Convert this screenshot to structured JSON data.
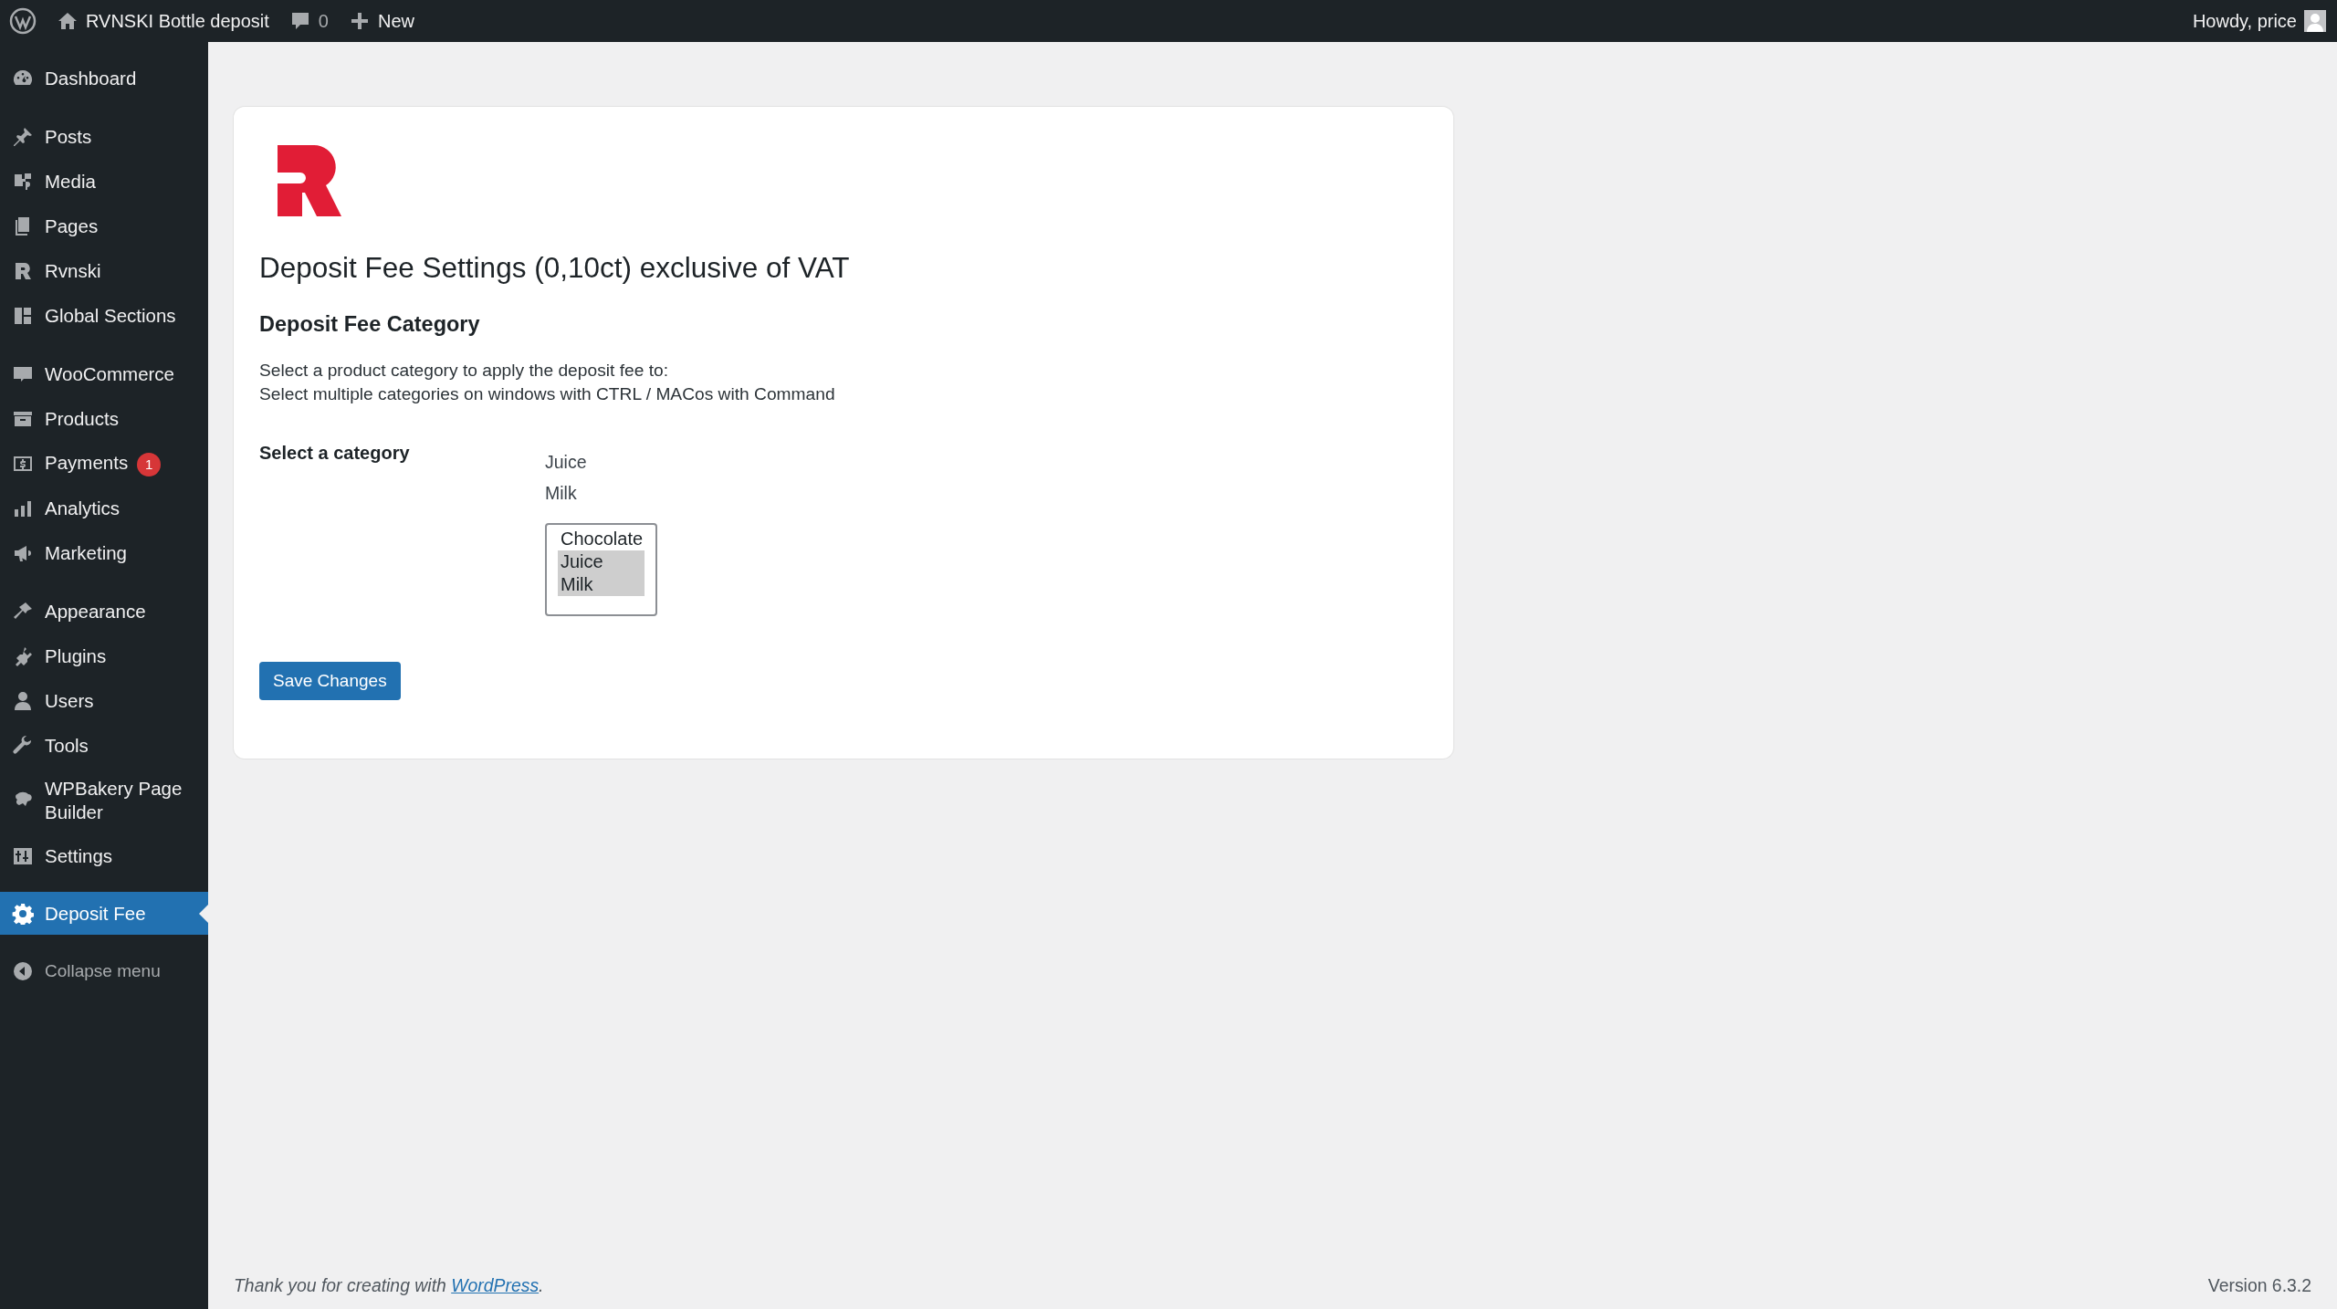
{
  "admin_bar": {
    "site_title": "RVNSKI Bottle deposit",
    "comments_count": "0",
    "new_label": "New",
    "greeting": "Howdy, price"
  },
  "sidebar": {
    "groups": [
      [
        {
          "label": "Dashboard",
          "selected": false
        }
      ],
      [
        {
          "label": "Posts",
          "selected": false
        },
        {
          "label": "Media",
          "selected": false
        },
        {
          "label": "Pages",
          "selected": false
        },
        {
          "label": "Rvnski",
          "selected": false
        },
        {
          "label": "Global Sections",
          "selected": false
        }
      ],
      [
        {
          "label": "WooCommerce",
          "selected": false
        },
        {
          "label": "Products",
          "selected": false
        },
        {
          "label": "Payments",
          "selected": false,
          "badge": "1"
        },
        {
          "label": "Analytics",
          "selected": false
        },
        {
          "label": "Marketing",
          "selected": false
        }
      ],
      [
        {
          "label": "Appearance",
          "selected": false
        },
        {
          "label": "Plugins",
          "selected": false
        },
        {
          "label": "Users",
          "selected": false
        },
        {
          "label": "Tools",
          "selected": false
        },
        {
          "label": "WPBakery Page Builder",
          "selected": false
        },
        {
          "label": "Settings",
          "selected": false
        }
      ],
      [
        {
          "label": "Deposit Fee",
          "selected": true
        }
      ]
    ],
    "collapse_label": "Collapse menu"
  },
  "settings": {
    "title": "Deposit Fee Settings (0,10ct) exclusive of VAT",
    "section_heading": "Deposit Fee Category",
    "description": [
      "Select a product category to apply the deposit fee to:",
      "Select multiple categories on windows with CTRL / MACos with Command"
    ],
    "field_label": "Select a category",
    "current_values": [
      "Juice",
      "Milk"
    ],
    "options": [
      {
        "label": "Chocolate",
        "selected": false
      },
      {
        "label": "Juice",
        "selected": true
      },
      {
        "label": "Milk",
        "selected": true
      }
    ],
    "save_button": "Save Changes"
  },
  "footer": {
    "thanks_before": "Thank you for creating with ",
    "thanks_link": "WordPress",
    "thanks_after": ".",
    "version": "Version 6.3.2"
  }
}
